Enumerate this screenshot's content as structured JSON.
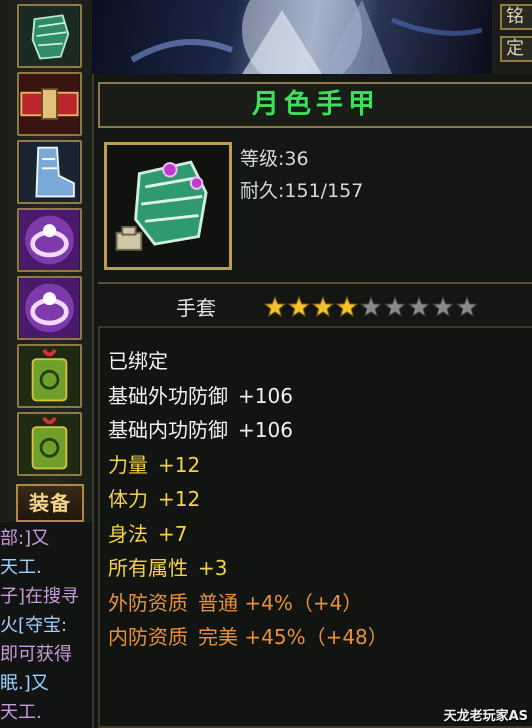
{
  "right_buttons": [
    "铭",
    "定"
  ],
  "equip_tab_label": "装备",
  "chat_lines": [
    {
      "text": "部:]又",
      "color": "#c99bd8"
    },
    {
      "text": "天工.",
      "color": "#9fd0ff"
    },
    {
      "text": "子]在搜寻",
      "color": "#c99bd8"
    },
    {
      "text": "火[夺宝:",
      "color": "#9fd0ff"
    },
    {
      "text": "即可获得",
      "color": "#c99bd8"
    },
    {
      "text": "眠.]又",
      "color": "#9fd0ff"
    },
    {
      "text": "天工.",
      "color": "#c99bd8"
    }
  ],
  "item": {
    "name": "月色手甲",
    "level_label": "等级:",
    "level": "36",
    "durability_label": "耐久:",
    "durability": "151/157",
    "type": "手套",
    "stars_filled": 4,
    "stars_total": 9
  },
  "attributes": [
    {
      "key": "已绑定",
      "value": "",
      "color": "#f2f2f2"
    },
    {
      "key": "基础外功防御",
      "value": "+106",
      "color": "#f2f2f2"
    },
    {
      "key": "基础内功防御",
      "value": "+106",
      "color": "#f2f2f2"
    },
    {
      "key": "力量",
      "value": "+12",
      "color": "#f5d24a"
    },
    {
      "key": "体力",
      "value": "+12",
      "color": "#f5d24a"
    },
    {
      "key": "身法",
      "value": "+7",
      "color": "#f5d24a"
    },
    {
      "key": "所有属性",
      "value": "+3",
      "color": "#f5d24a"
    },
    {
      "key": "外防资质",
      "value": "普通 +4%（+4）",
      "color": "#e8913a"
    },
    {
      "key": "内防资质",
      "value": "完美 +45%（+48）",
      "color": "#e8913a"
    }
  ],
  "watermark": "天龙老玩家AS",
  "colors": {
    "name_green": "#3ee05a",
    "gold_border": "#c09c52",
    "star_gold": "#f2c12e",
    "star_gray": "#8a8a8a"
  }
}
